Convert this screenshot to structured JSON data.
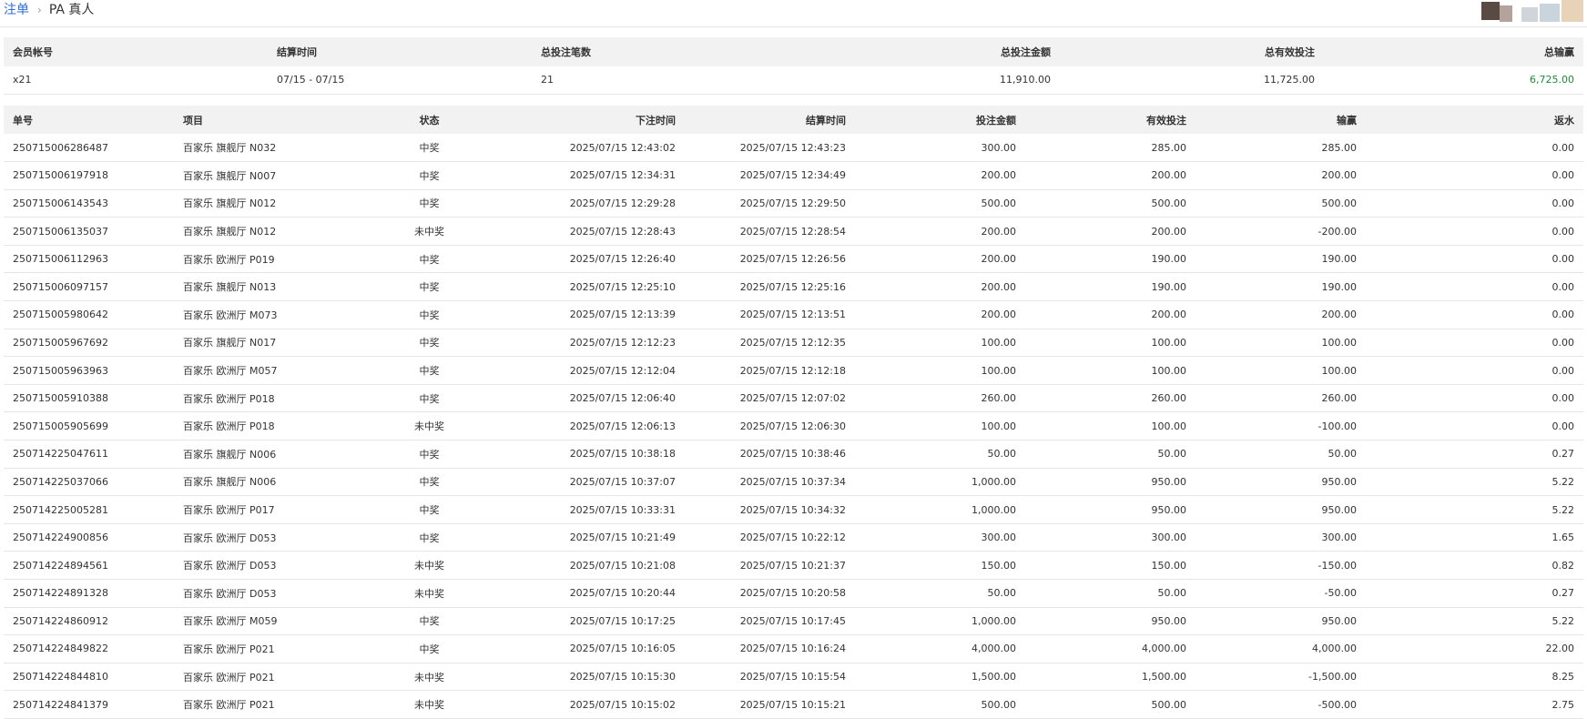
{
  "breadcrumb": {
    "root": "注单",
    "current": "PA 真人"
  },
  "colors": {
    "win": "#1e8a3c",
    "lose": "#cc2020",
    "link": "#2f6fd8"
  },
  "summary": {
    "headers": [
      "会员帐号",
      "结算时间",
      "总投注笔数",
      "总投注金额",
      "总有效投注",
      "总输赢"
    ],
    "row": {
      "account": "x21",
      "settle_range": "07/15 - 07/15",
      "bet_count": "21",
      "total_bet": "11,910.00",
      "total_valid": "11,725.00",
      "total_winloss": "6,725.00"
    }
  },
  "detail": {
    "headers": [
      "单号",
      "项目",
      "状态",
      "下注时间",
      "结算时间",
      "投注金额",
      "有效投注",
      "输赢",
      "返水"
    ],
    "rows": [
      {
        "id": "250715006286487",
        "item": "百家乐 旗舰厅 N032",
        "status": "中奖",
        "bet_time": "2025/07/15 12:43:02",
        "settle_time": "2025/07/15 12:43:23",
        "bet": "300.00",
        "valid": "285.00",
        "winloss": "285.00",
        "rebate": "0.00"
      },
      {
        "id": "250715006197918",
        "item": "百家乐 旗舰厅 N007",
        "status": "中奖",
        "bet_time": "2025/07/15 12:34:31",
        "settle_time": "2025/07/15 12:34:49",
        "bet": "200.00",
        "valid": "200.00",
        "winloss": "200.00",
        "rebate": "0.00"
      },
      {
        "id": "250715006143543",
        "item": "百家乐 旗舰厅 N012",
        "status": "中奖",
        "bet_time": "2025/07/15 12:29:28",
        "settle_time": "2025/07/15 12:29:50",
        "bet": "500.00",
        "valid": "500.00",
        "winloss": "500.00",
        "rebate": "0.00"
      },
      {
        "id": "250715006135037",
        "item": "百家乐 旗舰厅 N012",
        "status": "未中奖",
        "bet_time": "2025/07/15 12:28:43",
        "settle_time": "2025/07/15 12:28:54",
        "bet": "200.00",
        "valid": "200.00",
        "winloss": "-200.00",
        "rebate": "0.00"
      },
      {
        "id": "250715006112963",
        "item": "百家乐 欧洲厅 P019",
        "status": "中奖",
        "bet_time": "2025/07/15 12:26:40",
        "settle_time": "2025/07/15 12:26:56",
        "bet": "200.00",
        "valid": "190.00",
        "winloss": "190.00",
        "rebate": "0.00"
      },
      {
        "id": "250715006097157",
        "item": "百家乐 旗舰厅 N013",
        "status": "中奖",
        "bet_time": "2025/07/15 12:25:10",
        "settle_time": "2025/07/15 12:25:16",
        "bet": "200.00",
        "valid": "190.00",
        "winloss": "190.00",
        "rebate": "0.00"
      },
      {
        "id": "250715005980642",
        "item": "百家乐 欧洲厅 M073",
        "status": "中奖",
        "bet_time": "2025/07/15 12:13:39",
        "settle_time": "2025/07/15 12:13:51",
        "bet": "200.00",
        "valid": "200.00",
        "winloss": "200.00",
        "rebate": "0.00"
      },
      {
        "id": "250715005967692",
        "item": "百家乐 旗舰厅 N017",
        "status": "中奖",
        "bet_time": "2025/07/15 12:12:23",
        "settle_time": "2025/07/15 12:12:35",
        "bet": "100.00",
        "valid": "100.00",
        "winloss": "100.00",
        "rebate": "0.00"
      },
      {
        "id": "250715005963963",
        "item": "百家乐 欧洲厅 M057",
        "status": "中奖",
        "bet_time": "2025/07/15 12:12:04",
        "settle_time": "2025/07/15 12:12:18",
        "bet": "100.00",
        "valid": "100.00",
        "winloss": "100.00",
        "rebate": "0.00"
      },
      {
        "id": "250715005910388",
        "item": "百家乐 欧洲厅 P018",
        "status": "中奖",
        "bet_time": "2025/07/15 12:06:40",
        "settle_time": "2025/07/15 12:07:02",
        "bet": "260.00",
        "valid": "260.00",
        "winloss": "260.00",
        "rebate": "0.00"
      },
      {
        "id": "250715005905699",
        "item": "百家乐 欧洲厅 P018",
        "status": "未中奖",
        "bet_time": "2025/07/15 12:06:13",
        "settle_time": "2025/07/15 12:06:30",
        "bet": "100.00",
        "valid": "100.00",
        "winloss": "-100.00",
        "rebate": "0.00"
      },
      {
        "id": "250714225047611",
        "item": "百家乐 旗舰厅 N006",
        "status": "中奖",
        "bet_time": "2025/07/15 10:38:18",
        "settle_time": "2025/07/15 10:38:46",
        "bet": "50.00",
        "valid": "50.00",
        "winloss": "50.00",
        "rebate": "0.27"
      },
      {
        "id": "250714225037066",
        "item": "百家乐 旗舰厅 N006",
        "status": "中奖",
        "bet_time": "2025/07/15 10:37:07",
        "settle_time": "2025/07/15 10:37:34",
        "bet": "1,000.00",
        "valid": "950.00",
        "winloss": "950.00",
        "rebate": "5.22"
      },
      {
        "id": "250714225005281",
        "item": "百家乐 欧洲厅 P017",
        "status": "中奖",
        "bet_time": "2025/07/15 10:33:31",
        "settle_time": "2025/07/15 10:34:32",
        "bet": "1,000.00",
        "valid": "950.00",
        "winloss": "950.00",
        "rebate": "5.22"
      },
      {
        "id": "250714224900856",
        "item": "百家乐 欧洲厅 D053",
        "status": "中奖",
        "bet_time": "2025/07/15 10:21:49",
        "settle_time": "2025/07/15 10:22:12",
        "bet": "300.00",
        "valid": "300.00",
        "winloss": "300.00",
        "rebate": "1.65"
      },
      {
        "id": "250714224894561",
        "item": "百家乐 欧洲厅 D053",
        "status": "未中奖",
        "bet_time": "2025/07/15 10:21:08",
        "settle_time": "2025/07/15 10:21:37",
        "bet": "150.00",
        "valid": "150.00",
        "winloss": "-150.00",
        "rebate": "0.82"
      },
      {
        "id": "250714224891328",
        "item": "百家乐 欧洲厅 D053",
        "status": "未中奖",
        "bet_time": "2025/07/15 10:20:44",
        "settle_time": "2025/07/15 10:20:58",
        "bet": "50.00",
        "valid": "50.00",
        "winloss": "-50.00",
        "rebate": "0.27"
      },
      {
        "id": "250714224860912",
        "item": "百家乐 欧洲厅 M059",
        "status": "中奖",
        "bet_time": "2025/07/15 10:17:25",
        "settle_time": "2025/07/15 10:17:45",
        "bet": "1,000.00",
        "valid": "950.00",
        "winloss": "950.00",
        "rebate": "5.22"
      },
      {
        "id": "250714224849822",
        "item": "百家乐 欧洲厅 P021",
        "status": "中奖",
        "bet_time": "2025/07/15 10:16:05",
        "settle_time": "2025/07/15 10:16:24",
        "bet": "4,000.00",
        "valid": "4,000.00",
        "winloss": "4,000.00",
        "rebate": "22.00"
      },
      {
        "id": "250714224844810",
        "item": "百家乐 欧洲厅 P021",
        "status": "未中奖",
        "bet_time": "2025/07/15 10:15:30",
        "settle_time": "2025/07/15 10:15:54",
        "bet": "1,500.00",
        "valid": "1,500.00",
        "winloss": "-1,500.00",
        "rebate": "8.25"
      },
      {
        "id": "250714224841379",
        "item": "百家乐 欧洲厅 P021",
        "status": "未中奖",
        "bet_time": "2025/07/15 10:15:02",
        "settle_time": "2025/07/15 10:15:21",
        "bet": "500.00",
        "valid": "500.00",
        "winloss": "-500.00",
        "rebate": "2.75"
      }
    ]
  }
}
